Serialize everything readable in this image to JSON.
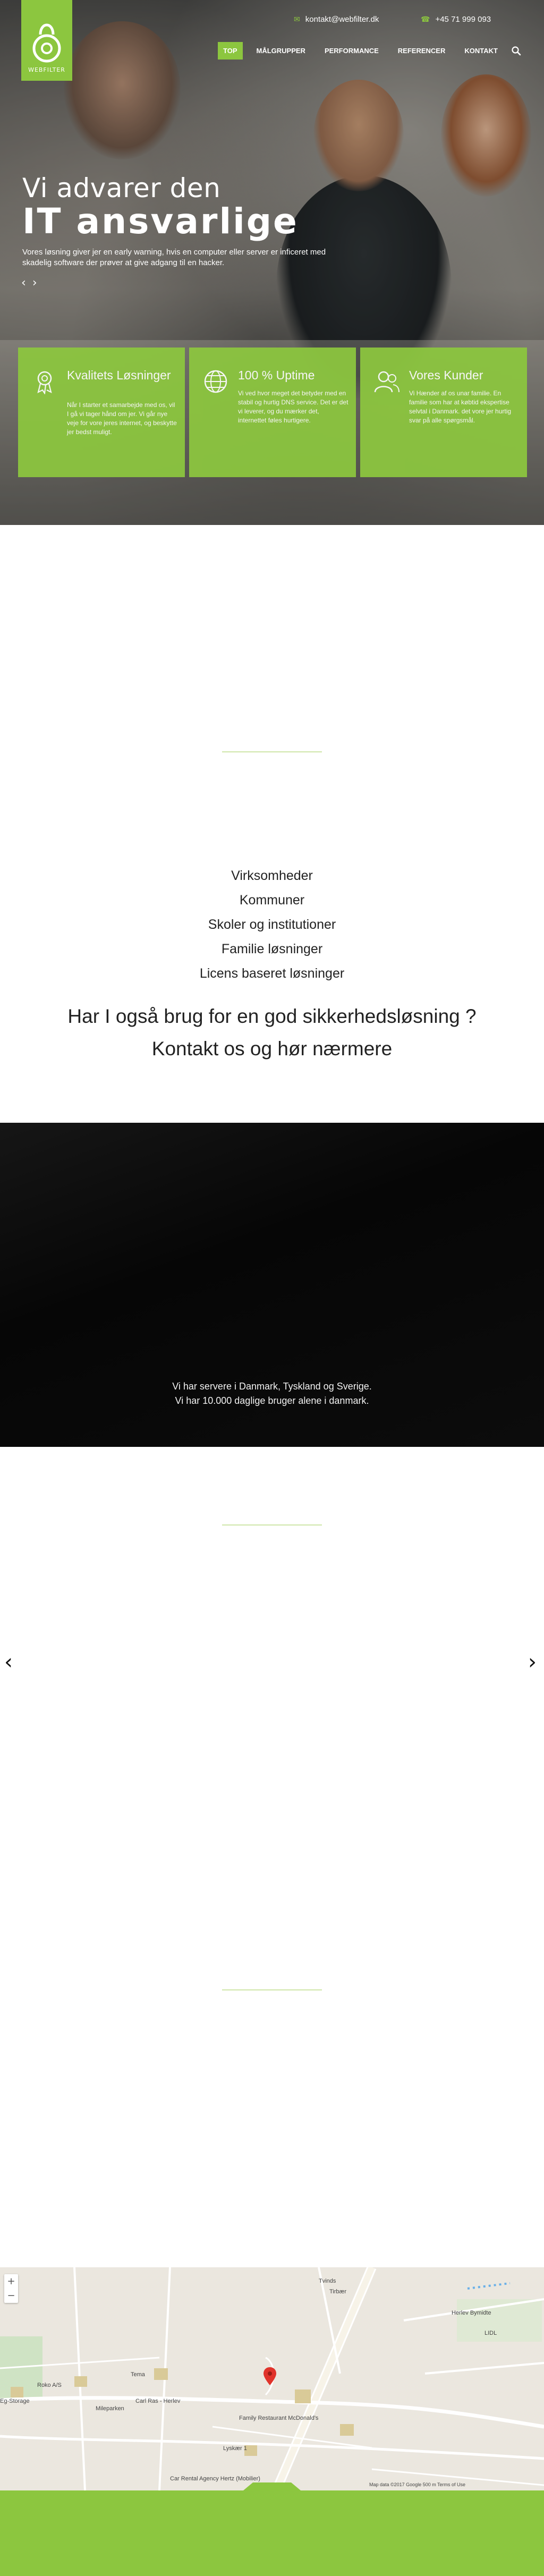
{
  "brand": {
    "logo_text": "WEBFILTER",
    "accent": "#8cc63f"
  },
  "topbar": {
    "email": "kontakt@webfilter.dk",
    "phone": "+45 71 999 093"
  },
  "nav": {
    "items": [
      "TOP",
      "MÅLGRUPPER",
      "PERFORMANCE",
      "REFERENCER",
      "KONTAKT"
    ],
    "active": "TOP"
  },
  "hero": {
    "line1": "Vi advarer den",
    "line2": "IT ansvarlige",
    "text": "Vores løsning giver jer en early warning, hvis en computer eller server er inficeret med skadelig software der prøver at give adgang til en hacker."
  },
  "features": [
    {
      "icon": "award-icon",
      "title": "Kvalitets Løsninger",
      "body": "Når I starter et samarbejde med os, vil I gå vi tager hånd om jer. Vi går nye veje for vore jeres internet, og beskytte jer bedst muligt."
    },
    {
      "icon": "globe-icon",
      "title": "100 % Uptime",
      "body": "Vi ved hvor meget det betyder med en stabil og hurtig DNS service. Det er det vi leverer, og du mærker det, internettet føles hurtigere."
    },
    {
      "icon": "users-icon",
      "title": "Vores Kunder",
      "body": "Vi Hænder af os unar familie. En familie som har at købtid ekspertise selvtal i Danmark. det vore jer hurtig svar på alle spørgsmål."
    }
  ],
  "audiences": [
    "Virksomheder",
    "Kommuner",
    "Skoler og institutioner",
    "Familie løsninger",
    "Licens baseret løsninger"
  ],
  "cta": {
    "line1": "Har I også brug for en god sikkerhedsløsning ?",
    "line2": "Kontakt os og hør nærmere"
  },
  "servers": {
    "line1": "Vi har servere i Danmark, Tyskland og Sverige.",
    "line2": "Vi har 10.000 daglige bruger alene i danmark."
  },
  "slider": {
    "prev": "‹",
    "next": "›"
  },
  "map": {
    "labels": [
      "Roko A/S",
      "Carl Ras - Herlev",
      "Family Restaurant McDonald's",
      "Lyskær 1",
      "Car Rental Agency Hertz (Mobilier)",
      "Tvinds",
      "Tirbær",
      "LIDL",
      "Tema",
      "Mileparken",
      "Eg-Storage",
      "Herlev Bymidte"
    ],
    "attribution": "Map data ©2017 Google   500 m   Terms of Use",
    "zoom_in": "+",
    "zoom_out": "−"
  }
}
